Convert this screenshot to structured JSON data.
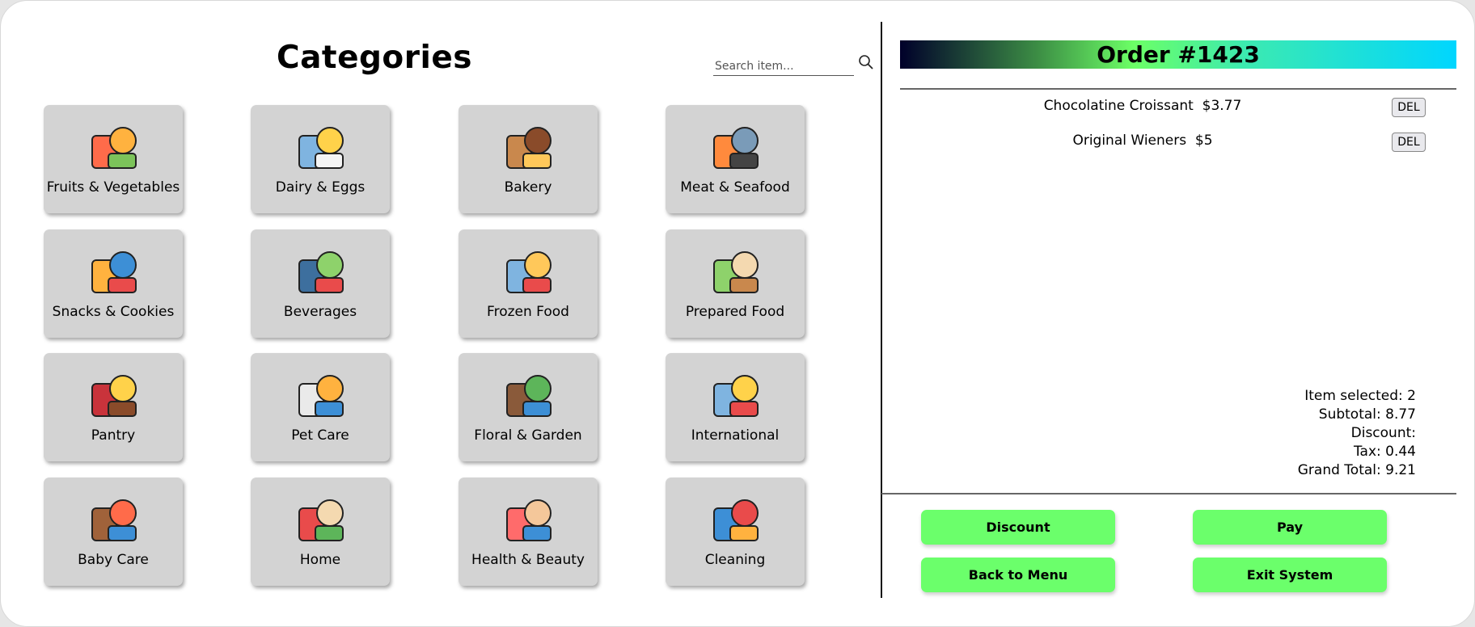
{
  "categories": {
    "title": "Categories",
    "search_placeholder": "Search item...",
    "search_icon": "magnifier-icon",
    "items": [
      {
        "label": "Fruits & Vegetables",
        "icon": "fruits-vegetables-icon"
      },
      {
        "label": "Dairy & Eggs",
        "icon": "dairy-eggs-icon"
      },
      {
        "label": "Bakery",
        "icon": "bread-icon"
      },
      {
        "label": "Meat & Seafood",
        "icon": "meat-seafood-icon"
      },
      {
        "label": "Snacks & Cookies",
        "icon": "snacks-icon"
      },
      {
        "label": "Beverages",
        "icon": "bottles-icon"
      },
      {
        "label": "Frozen Food",
        "icon": "frozen-bag-icon"
      },
      {
        "label": "Prepared Food",
        "icon": "salad-bowl-icon"
      },
      {
        "label": "Pantry",
        "icon": "condiments-icon"
      },
      {
        "label": "Pet Care",
        "icon": "pet-food-icon"
      },
      {
        "label": "Floral & Garden",
        "icon": "plant-shovel-icon"
      },
      {
        "label": "International",
        "icon": "noodle-bowl-icon"
      },
      {
        "label": "Baby Care",
        "icon": "teddy-bear-icon"
      },
      {
        "label": "Home",
        "icon": "house-icon"
      },
      {
        "label": "Health & Beauty",
        "icon": "heart-hand-icon"
      },
      {
        "label": "Cleaning",
        "icon": "cleaning-bucket-icon"
      }
    ]
  },
  "order": {
    "title": "Order #1423",
    "gradient_colors": [
      "#00002a",
      "#6cff66",
      "#00d6ff"
    ],
    "items": [
      {
        "text": "Chocolatine Croissant  $3.77",
        "del_label": "DEL"
      },
      {
        "text": "Original Wieners  $5",
        "del_label": "DEL"
      }
    ],
    "summary": {
      "items_selected": "Item selected: 2",
      "subtotal": "Subtotal: 8.77",
      "discount": "Discount:",
      "tax": "Tax: 0.44",
      "grand_total": "Grand Total: 9.21"
    },
    "buttons": {
      "discount": "Discount",
      "pay": "Pay",
      "back": "Back to Menu",
      "exit": "Exit System"
    },
    "button_color": "#6bff6b"
  }
}
